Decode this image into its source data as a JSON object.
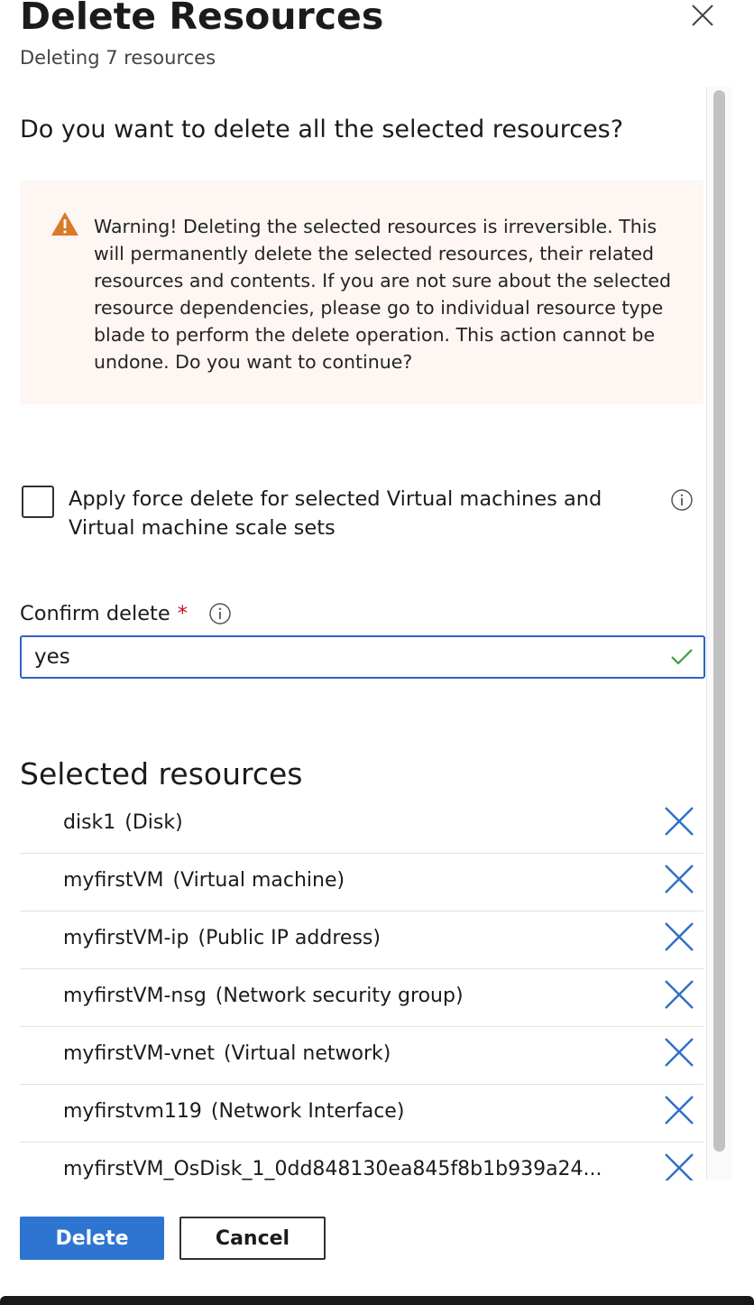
{
  "header": {
    "title": "Delete Resources",
    "subtitle": "Deleting 7 resources"
  },
  "icons": {
    "close": "close-icon",
    "warning": "warning-triangle-icon",
    "info": "info-icon",
    "check": "checkmark-icon",
    "remove": "remove-x-icon"
  },
  "main": {
    "question": "Do you want to delete all the selected resources?",
    "warning_text": "Warning! Deleting the selected resources is irreversible. This will permanently delete the selected resources, their related resources and contents. If you are not sure about the selected resource dependencies, please go to individual resource type blade to perform the delete operation. This action cannot be undone. Do you want to continue?",
    "force_delete": {
      "label": "Apply force delete for selected Virtual machines and Virtual machine scale sets",
      "checked": false
    },
    "confirm": {
      "label": "Confirm delete",
      "required_mark": "*",
      "value": "yes"
    },
    "selected_title": "Selected resources",
    "resources": [
      {
        "name": "disk1",
        "type": "(Disk)"
      },
      {
        "name": "myfirstVM",
        "type": "(Virtual machine)"
      },
      {
        "name": "myfirstVM-ip",
        "type": "(Public IP address)"
      },
      {
        "name": "myfirstVM-nsg",
        "type": "(Network security group)"
      },
      {
        "name": "myfirstVM-vnet",
        "type": "(Virtual network)"
      },
      {
        "name": "myfirstvm119",
        "type": "(Network Interface)"
      },
      {
        "name": "myfirstVM_OsDisk_1_0dd848130ea845f8b1b939a24...",
        "type": ""
      }
    ]
  },
  "footer": {
    "delete_label": "Delete",
    "cancel_label": "Cancel"
  },
  "colors": {
    "accent": "#2e74d1",
    "input_border": "#2b64c4",
    "warning_bg": "#fdf6f2",
    "warning_icon": "#d97a2a",
    "required": "#c50f1f",
    "success_check": "#3c9d3c",
    "remove_x": "#2e6fc8"
  }
}
